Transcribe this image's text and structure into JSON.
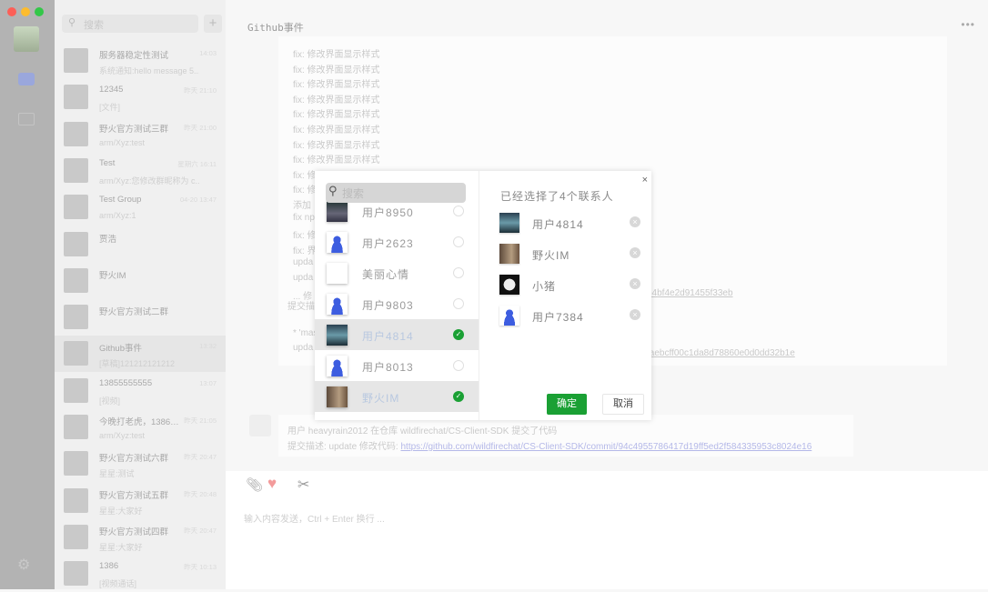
{
  "window": {
    "title": "Github事件",
    "traffic_colors": [
      "#fc5f57",
      "#fdbc2e",
      "#33c748"
    ]
  },
  "list": {
    "search_placeholder": "搜索",
    "add": "+",
    "conversations": [
      {
        "name": "服务器稳定性测试",
        "msg": "系统通知:hello message 5...",
        "time": "14:03"
      },
      {
        "name": "12345",
        "msg": "[文件]",
        "time": "昨天 21:10"
      },
      {
        "name": "野火官方测试三群",
        "msg": "arm/Xyz:test",
        "time": "昨天 21:00"
      },
      {
        "name": "Test",
        "msg": "arm/Xyz:您修改群昵称为 c...",
        "time": "星期六 16:11"
      },
      {
        "name": "Test Group",
        "msg": "arm/Xyz:1",
        "time": "04-20 13:47"
      },
      {
        "name": "贾浩",
        "msg": "",
        "time": ""
      },
      {
        "name": "野火IM",
        "msg": "",
        "time": ""
      },
      {
        "name": "野火官方测试二群",
        "msg": "",
        "time": ""
      },
      {
        "name": "Github事件",
        "msg": "[草稿]121212121212",
        "time": "13:32"
      },
      {
        "name": "13855555555",
        "msg": "[视频]",
        "time": "13:07"
      },
      {
        "name": "今晚打老虎，1386…",
        "msg": "arm/Xyz:test",
        "time": "昨天 21:05"
      },
      {
        "name": "野火官方测试六群",
        "msg": "星星:测试",
        "time": "昨天 20:47"
      },
      {
        "name": "野火官方测试五群",
        "msg": "星星:大家好",
        "time": "昨天 20:48"
      },
      {
        "name": "野火官方测试四群",
        "msg": "星星:大家好",
        "time": "昨天 20:47"
      },
      {
        "name": "1386",
        "msg": "[视频通话]",
        "time": "昨天 10:13"
      }
    ]
  },
  "chat": {
    "more": "•••",
    "lines": [
      "fix: 修改界面显示样式",
      "fix: 修改界面显示样式",
      "fix: 修改界面显示样式",
      "fix: 修改界面显示样式",
      "fix: 修改界面显示样式",
      "fix: 修改界面显示样式",
      "fix: 修改界面显示样式",
      "fix: 修改界面显示样式",
      "fix: 修",
      "fix: 修",
      "添加",
      "fix np",
      "fix: 修",
      "fix: 界",
      "upda",
      "upda",
      "... 修",
      "提交描",
      "* 'mast",
      "upda"
    ],
    "link1": "b4bf4e2d91455f33eb",
    "link2": "taebcff00c1da8d78860e0d0dd32b1e",
    "msg2_line1": "用户 heavyrain2012 在仓库 wildfirechat/CS-Client-SDK 提交了代码",
    "msg2_prefix": "提交描述: update 修改代码: ",
    "msg2_link": "https://github.com/wildfirechat/CS-Client-SDK/commit/94c4955786417d19ff5ed2f584335953c8024e16",
    "input_placeholder": "输入内容发送，Ctrl + Enter 换行 ..."
  },
  "modal": {
    "search_placeholder": "搜索",
    "contacts": [
      {
        "name": "用户8950",
        "checked": false
      },
      {
        "name": "用户2623",
        "checked": false
      },
      {
        "name": "美丽心情",
        "checked": false
      },
      {
        "name": "用户9803",
        "checked": false
      },
      {
        "name": "用户4814",
        "checked": true
      },
      {
        "name": "用户8013",
        "checked": false
      },
      {
        "name": "野火IM",
        "checked": true
      }
    ],
    "selected_title": "已经选择了4个联系人",
    "selected": [
      {
        "name": "用户4814"
      },
      {
        "name": "野火IM"
      },
      {
        "name": "小猪"
      },
      {
        "name": "用户7384"
      }
    ],
    "confirm": "确定",
    "cancel": "取消",
    "close": "×",
    "check": "✓",
    "remove": "×",
    "accent": "#1aa034"
  }
}
